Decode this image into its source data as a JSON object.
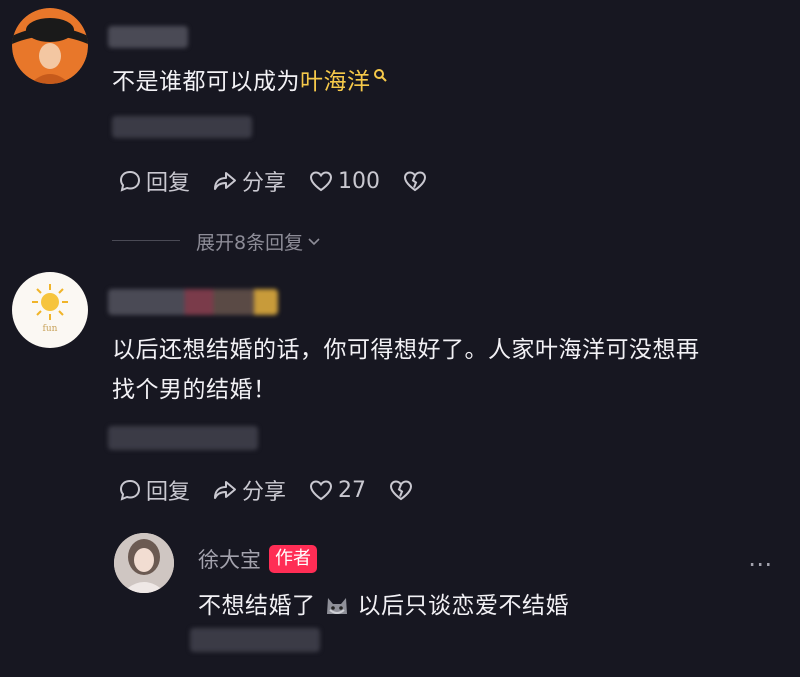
{
  "comments": [
    {
      "text_plain": "不是谁都可以成为",
      "text_link": "叶海洋",
      "actions": {
        "reply": "回复",
        "share": "分享",
        "likes": "100"
      },
      "expand_label": "展开8条回复"
    },
    {
      "avatar_caption": "fun",
      "text_line1": "以后还想结婚的话，你可得想好了。人家叶海洋可没想再",
      "text_line2": "找个男的结婚！",
      "actions": {
        "reply": "回复",
        "share": "分享",
        "likes": "27"
      }
    }
  ],
  "reply": {
    "username": "徐大宝",
    "badge": "作者",
    "text_before": "不想结婚了",
    "text_after": "以后只谈恋爱不结婚",
    "more": "⋯"
  },
  "colors": {
    "background": "#171721",
    "highlight": "#f6c94a",
    "badge": "#ff2d55"
  }
}
